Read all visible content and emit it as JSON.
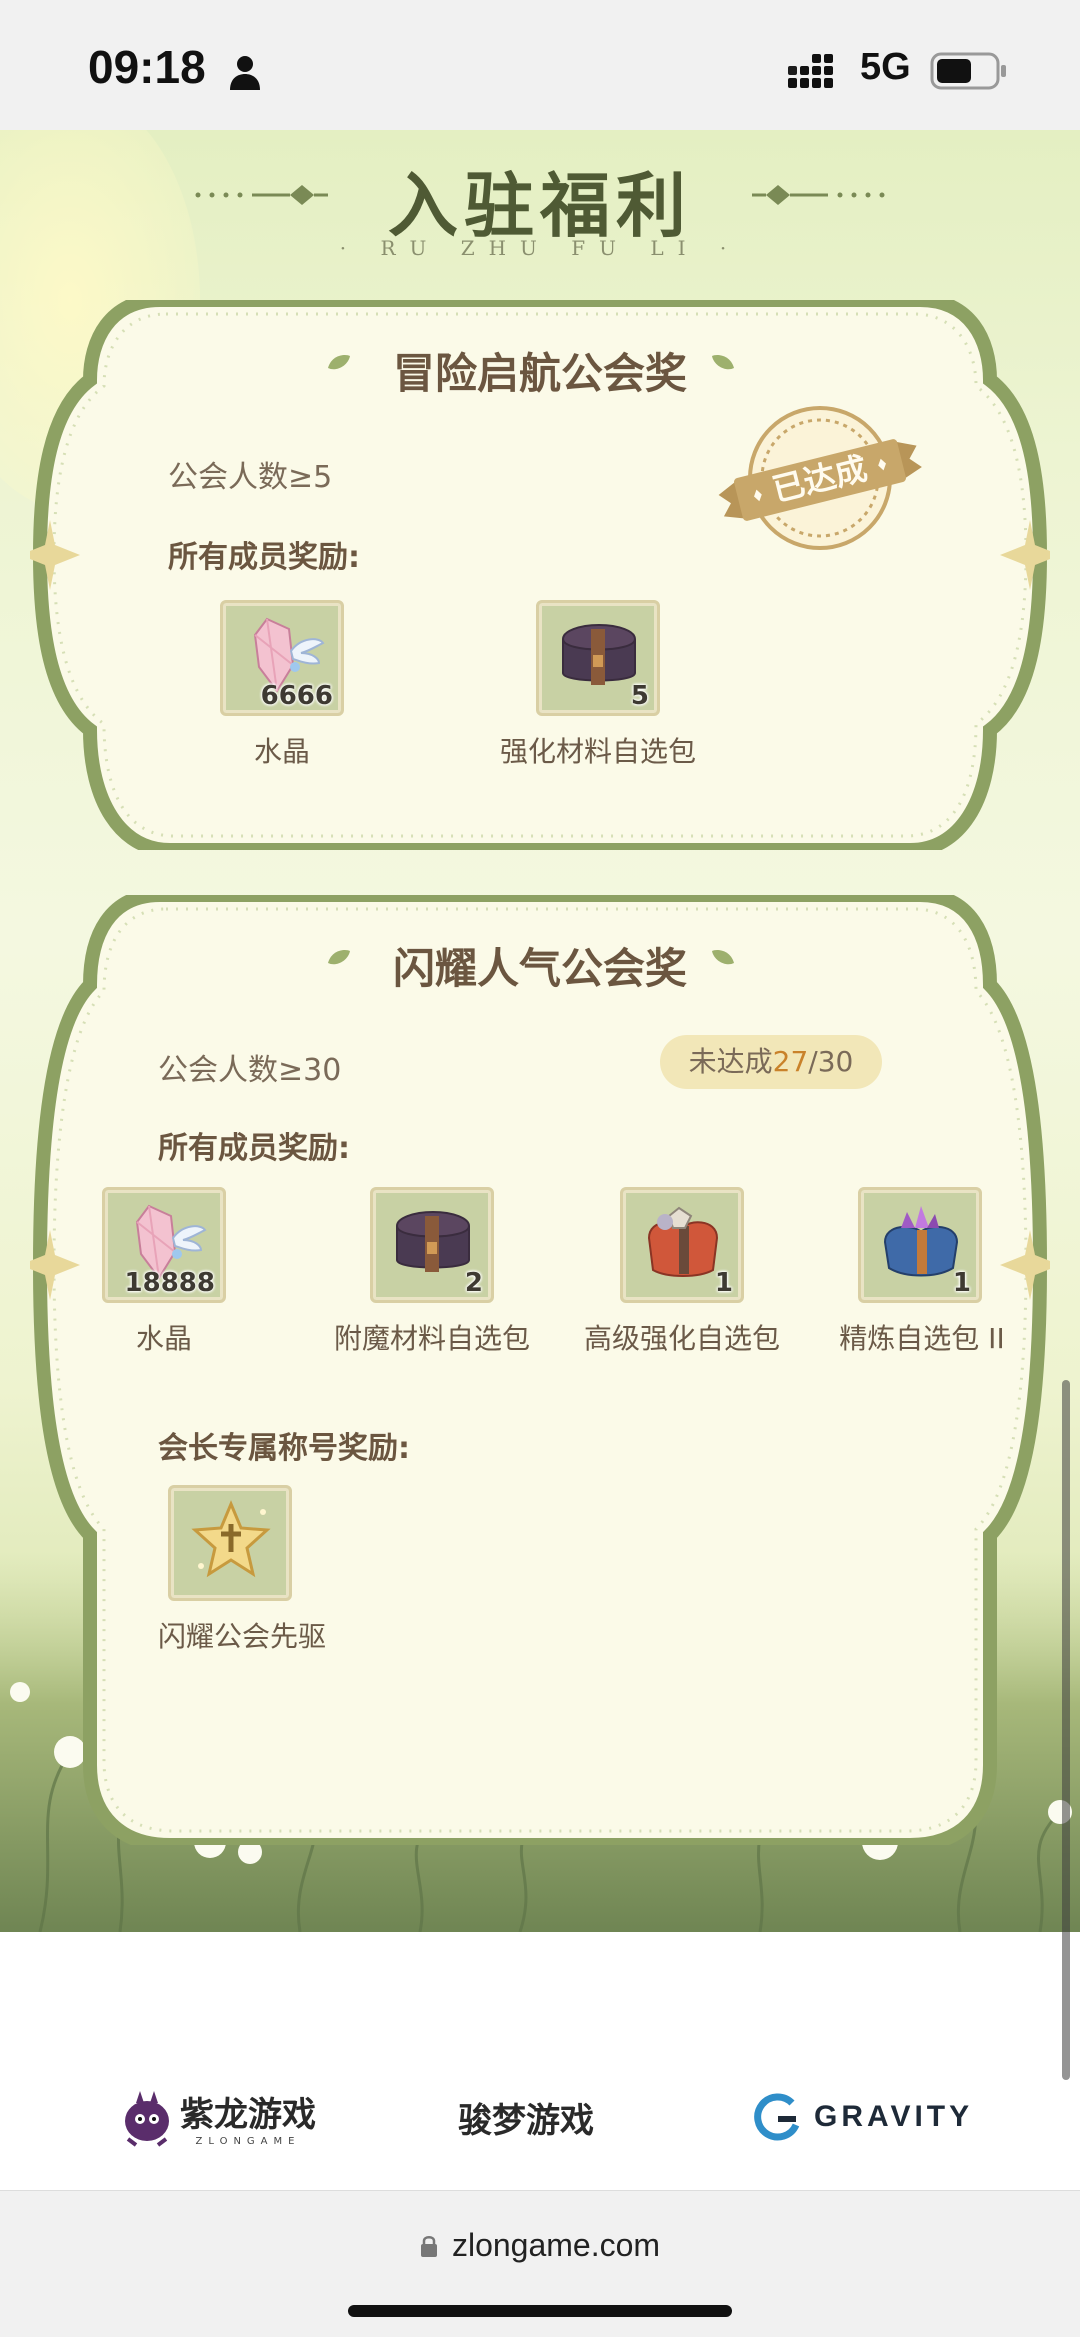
{
  "status_bar": {
    "time": "09:18",
    "network": "5G",
    "icons": [
      "person-icon",
      "signal-icon",
      "battery-icon"
    ]
  },
  "header": {
    "title": "入驻福利",
    "subtitle": "· RU ZHU FU LI ·"
  },
  "cards": [
    {
      "title": "冒险启航公会奖",
      "condition": "公会人数≥5",
      "stamp_text": "已达成",
      "members_label": "所有成员奖励:",
      "items": [
        {
          "name": "水晶",
          "count": "6666",
          "icon": "crystal-icon"
        },
        {
          "name": "强化材料自选包",
          "count": "5",
          "icon": "purple-chest-icon"
        }
      ]
    },
    {
      "title": "闪耀人气公会奖",
      "condition": "公会人数≥30",
      "status_prefix": "未达成",
      "status_current": "27",
      "status_total": "/30",
      "members_label": "所有成员奖励:",
      "items": [
        {
          "name": "水晶",
          "count": "18888",
          "icon": "crystal-icon"
        },
        {
          "name": "附魔材料自选包",
          "count": "2",
          "icon": "purple-chest-icon"
        },
        {
          "name": "高级强化自选包",
          "count": "1",
          "icon": "red-bag-icon"
        },
        {
          "name": "精炼自选包 II",
          "count": "1",
          "icon": "blue-bag-icon"
        }
      ],
      "leader_label": "会长专属称号奖励:",
      "leader_items": [
        {
          "name": "闪耀公会先驱",
          "icon": "star-badge-icon"
        }
      ]
    }
  ],
  "logos": [
    {
      "name": "紫龙游戏",
      "sub": "ZLONGAME"
    },
    {
      "name": "骏梦游戏"
    },
    {
      "name": "GRAVITY"
    }
  ],
  "address_bar": {
    "url": "zlongame.com"
  },
  "colors": {
    "frame_green": "#8da163",
    "title_brown": "#6b5640",
    "accent_orange": "#c9822a",
    "stamp_gold": "#c8a76a"
  }
}
